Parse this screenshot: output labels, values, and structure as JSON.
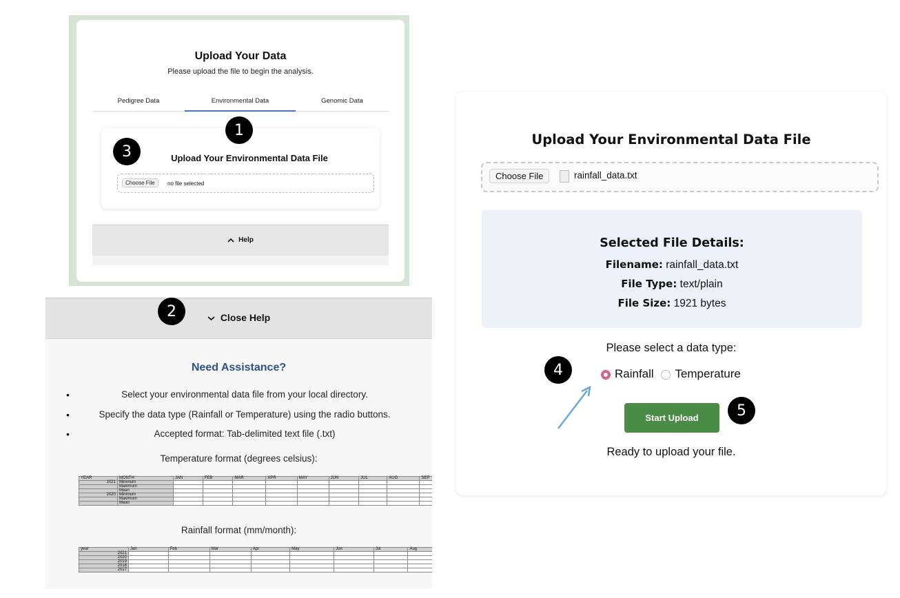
{
  "upload_panel": {
    "title": "Upload Your Data",
    "subtitle": "Please upload the file to begin the analysis.",
    "tabs": [
      {
        "label": "Pedigree Data"
      },
      {
        "label": "Environmental Data"
      },
      {
        "label": "Genomic Data"
      }
    ],
    "active_tab": "Environmental Data",
    "card_title": "Upload Your Environmental Data File",
    "choose_file_label": "Choose File",
    "file_status": "no file selected",
    "help_label": "Help"
  },
  "help_panel": {
    "close_label": "Close Help",
    "heading": "Need Assistance?",
    "bullets": [
      "Select your environmental data file from your local directory.",
      "Specify the data type (Rainfall or Temperature) using the radio buttons.",
      "Accepted format: Tab-delimited text file (.txt)"
    ],
    "temperature_label": "Temperature format (degrees celsius):",
    "temperature_table": {
      "headers": [
        "YEAR",
        "MONTH",
        "JAN",
        "FEB",
        "MAR",
        "APR",
        "MAY",
        "JUN",
        "JUL",
        "AUG",
        "SEP"
      ],
      "rows": [
        [
          "2021",
          "Minimum"
        ],
        [
          "",
          "Maximum"
        ],
        [
          "",
          "Mean"
        ],
        [
          "2020",
          "Minimum"
        ],
        [
          "",
          "Maximum"
        ],
        [
          "",
          "Mean"
        ]
      ]
    },
    "rainfall_label": "Rainfall format (mm/month):",
    "rainfall_table": {
      "headers": [
        "year",
        "Jan",
        "Feb",
        "Mar",
        "Apr",
        "May",
        "Jun",
        "Jul",
        "Aug"
      ],
      "rows": [
        [
          "2021"
        ],
        [
          "2020"
        ],
        [
          "2019"
        ],
        [
          "2018"
        ],
        [
          "2017"
        ]
      ]
    }
  },
  "selected_panel": {
    "title": "Upload Your Environmental Data File",
    "choose_file_label": "Choose File",
    "file_name": "rainfall_data.txt",
    "details_heading": "Selected File Details:",
    "filename_label": "Filename:",
    "filename_value": "rainfall_data.txt",
    "filetype_label": "File Type:",
    "filetype_value": "text/plain",
    "filesize_label": "File Size:",
    "filesize_value": "1921 bytes",
    "prompt": "Please select a data type:",
    "options": [
      "Rainfall",
      "Temperature"
    ],
    "selected_option": "Rainfall",
    "start_label": "Start Upload",
    "status": "Ready to upload your file."
  },
  "badges": [
    "1",
    "2",
    "3",
    "4",
    "5"
  ],
  "colors": {
    "accent_blue": "#4a72c8",
    "heading_blue": "#2d5288",
    "start_green": "#4a8b46",
    "radio_pink": "#d9608f",
    "arrow_blue": "#6aa8d8"
  }
}
